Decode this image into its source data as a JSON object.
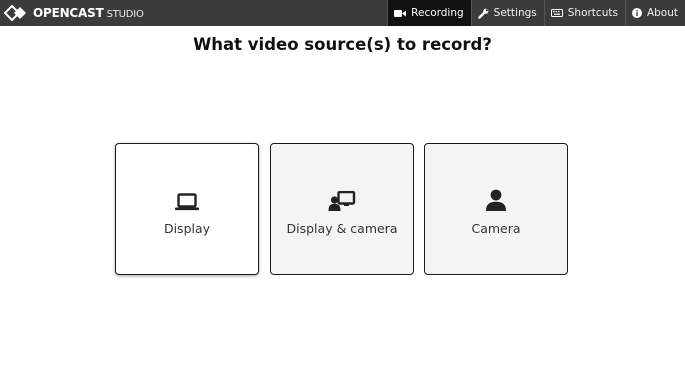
{
  "app": {
    "brand": "OPENCAST",
    "brand_sub": "STUDIO",
    "logo_icon": "opencast-logo-icon"
  },
  "nav": {
    "recording": {
      "label": "Recording",
      "icon": "video-camera-icon",
      "active": true
    },
    "settings": {
      "label": "Settings",
      "icon": "wrench-icon"
    },
    "shortcuts": {
      "label": "Shortcuts",
      "icon": "keyboard-icon"
    },
    "about": {
      "label": "About",
      "icon": "info-icon"
    }
  },
  "main": {
    "title": "What video source(s) to record?",
    "sources": [
      {
        "label": "Display",
        "icon": "laptop-icon"
      },
      {
        "label": "Display & camera",
        "icon": "display-camera-icon"
      },
      {
        "label": "Camera",
        "icon": "user-icon"
      }
    ]
  },
  "colors": {
    "topbar": "#3b3b3b",
    "active_tab": "#111111",
    "card_border": "#1a1a1a",
    "card_grey": "#f4f4f4"
  }
}
